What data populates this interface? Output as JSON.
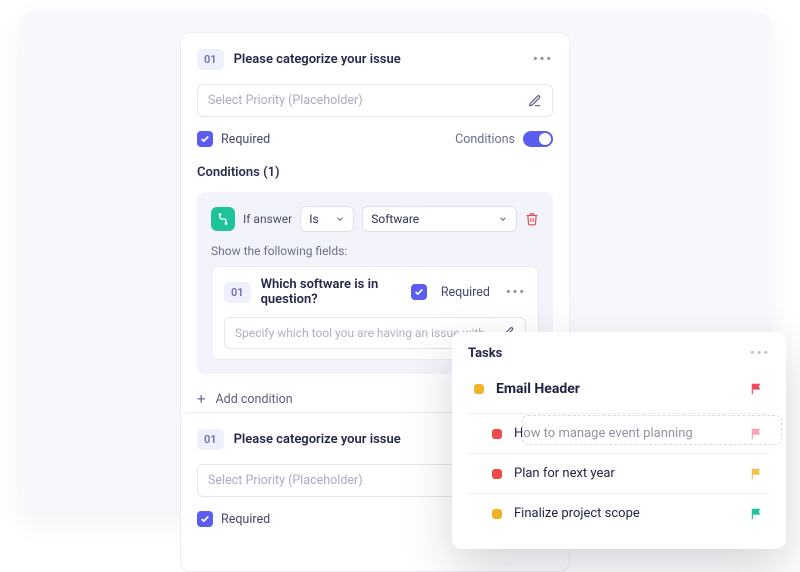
{
  "card1": {
    "num": "01",
    "title": "Please categorize your issue",
    "placeholder": "Select Priority (Placeholder)",
    "required_label": "Required",
    "conditions_label": "Conditions",
    "conditions_header": "Conditions (1)",
    "if_label": "If answer",
    "operator": "Is",
    "operand": "Software",
    "show_label": "Show the following fields:",
    "subq_num": "01",
    "subq_title": "Which software is in question?",
    "subq_required_label": "Required",
    "subq_placeholder": "Specify which tool you are having an issue with",
    "add_cond_label": "Add condition"
  },
  "card2": {
    "num": "01",
    "title": "Please categorize your issue",
    "placeholder": "Select Priority (Placeholder)",
    "required_label": "Required"
  },
  "tasks": {
    "header": "Tasks",
    "items": [
      {
        "label": "Email Header",
        "dot_color": "#f0b429",
        "flag_color": "#ef4a63",
        "primary": true
      },
      {
        "label": "How to manage event planning",
        "dot_color": "#ef4a4a",
        "flag_color": "#ef4a63"
      },
      {
        "label": "Plan for next year",
        "dot_color": "#ef4a4a",
        "flag_color": "#f2c24a"
      },
      {
        "label": "Finalize project scope",
        "dot_color": "#f0b429",
        "flag_color": "#1fc39a"
      }
    ]
  }
}
